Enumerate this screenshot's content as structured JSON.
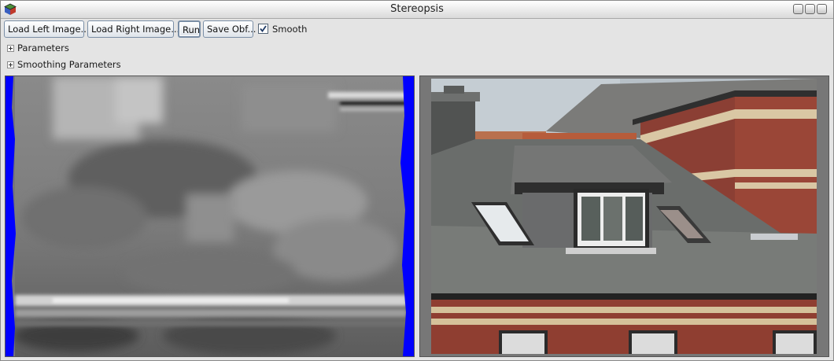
{
  "window": {
    "title": "Stereopsis"
  },
  "toolbar": {
    "load_left_label": "Load Left Image...",
    "load_right_label": "Load Right Image...",
    "run_label": "Run",
    "save_label": "Save Obf...",
    "smooth_label": "Smooth",
    "smooth_checked": true
  },
  "sections": [
    {
      "label": "Parameters",
      "expanded": false
    },
    {
      "label": "Smoothing Parameters",
      "expanded": false
    }
  ],
  "views": {
    "left": "disparity-map",
    "right": "right-image-photo"
  }
}
